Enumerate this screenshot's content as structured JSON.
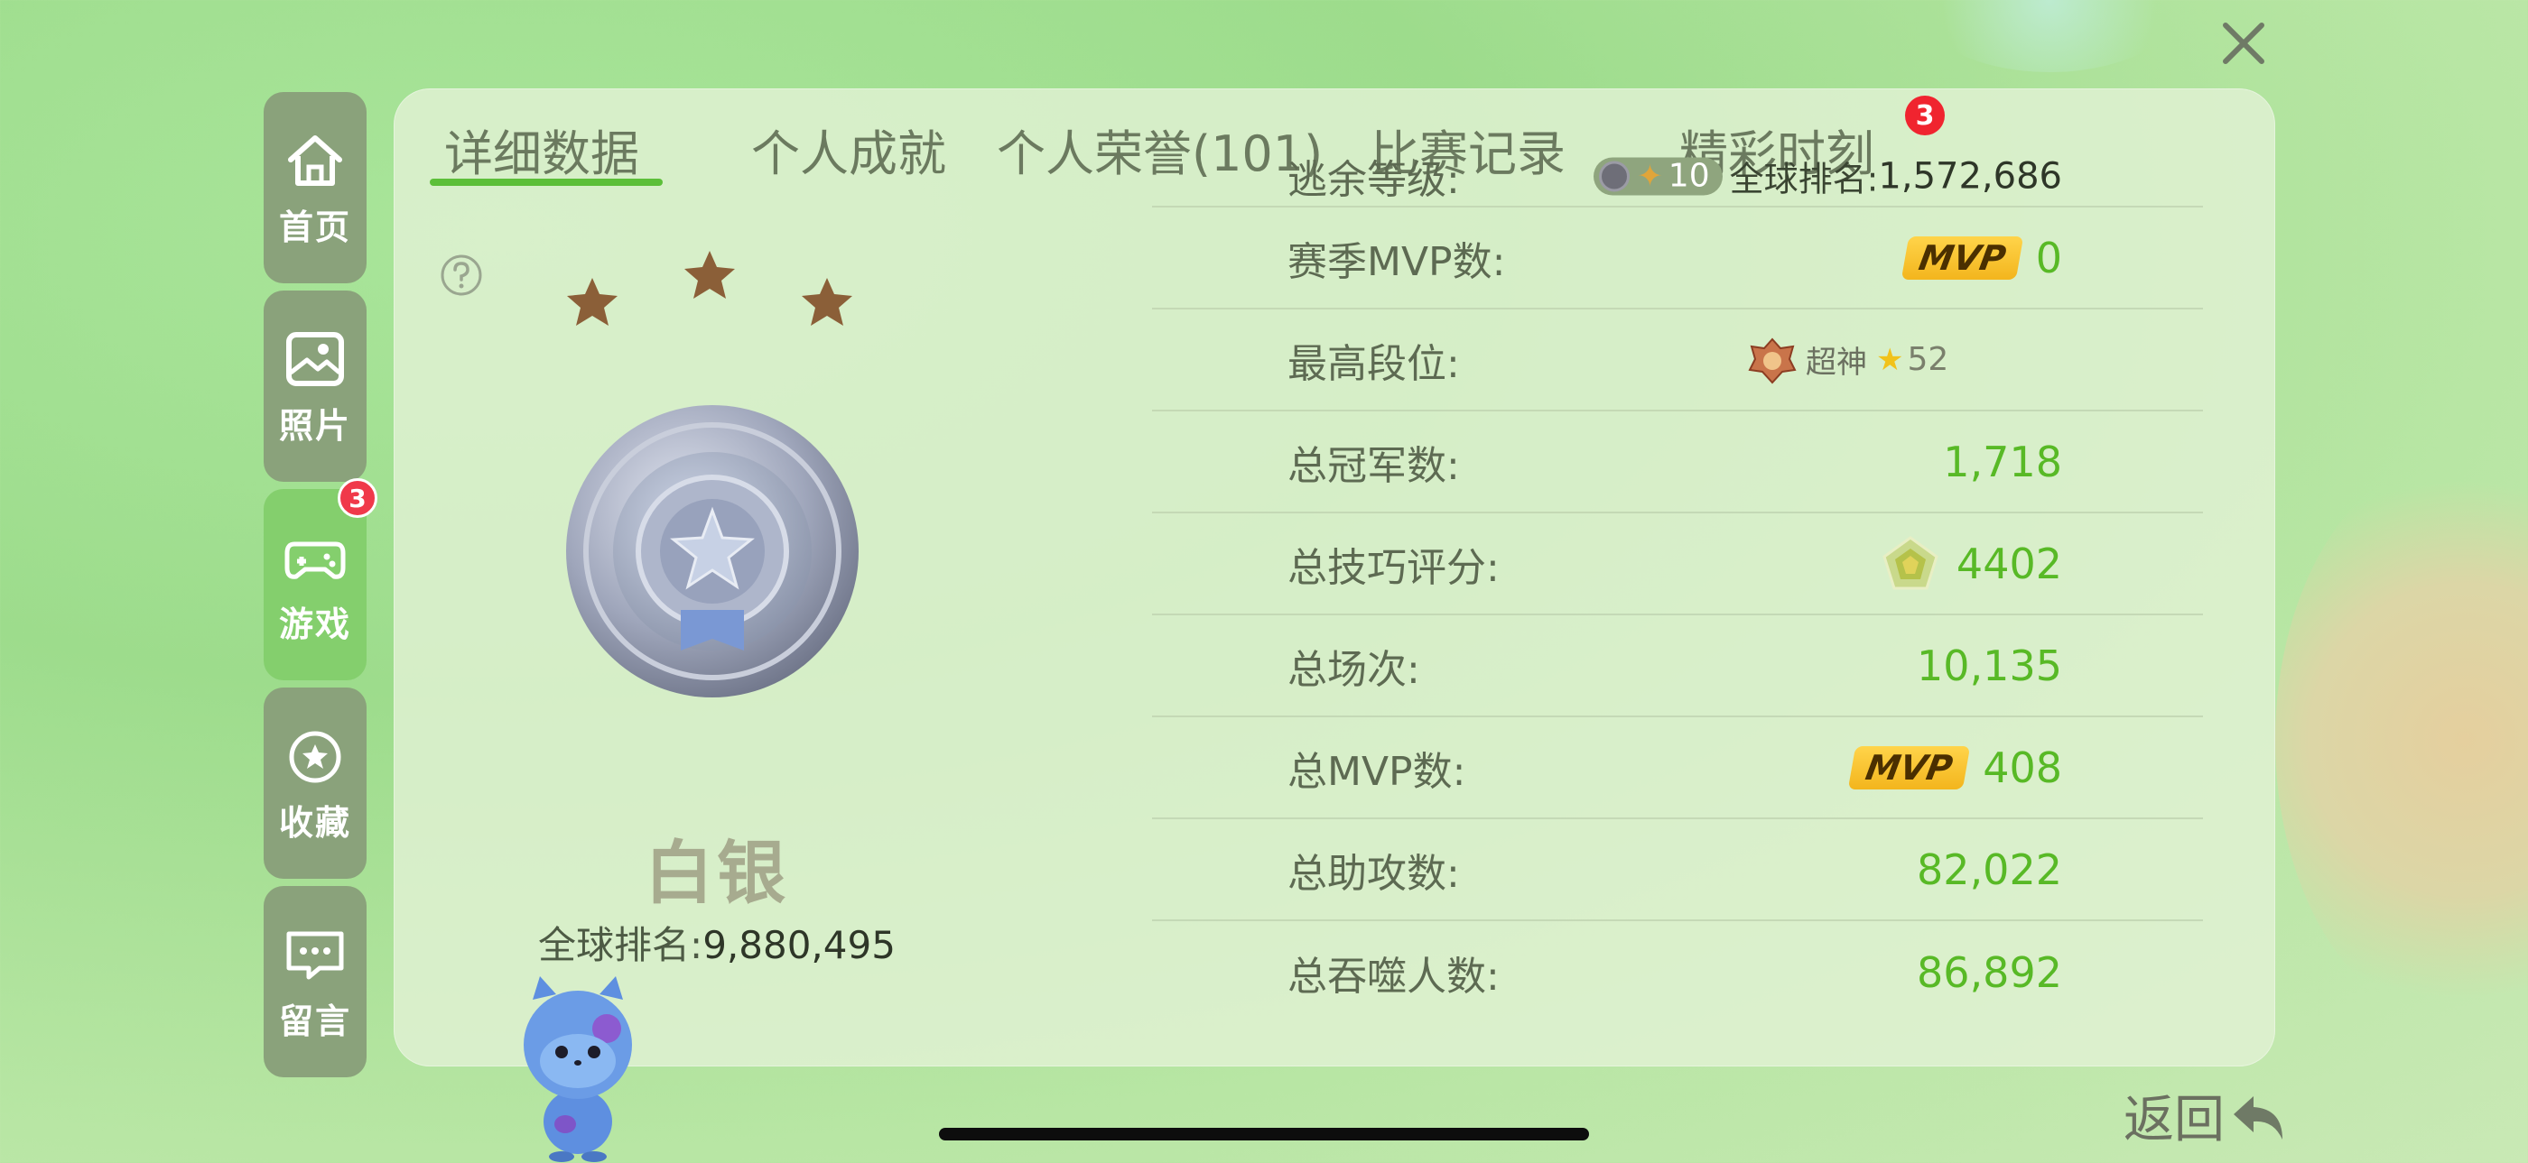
{
  "sidebar": {
    "items": [
      {
        "label": "首页",
        "icon": "home-icon"
      },
      {
        "label": "照片",
        "icon": "photo-icon"
      },
      {
        "label": "游戏",
        "icon": "gamepad-icon",
        "badge": "3"
      },
      {
        "label": "收藏",
        "icon": "star-icon"
      },
      {
        "label": "留言",
        "icon": "message-icon"
      }
    ]
  },
  "tabs": [
    {
      "label": "详细数据",
      "active": true
    },
    {
      "label": "个人成就"
    },
    {
      "label": "个人荣誉(101)"
    },
    {
      "label": "比赛记录"
    },
    {
      "label": "精彩时刻",
      "badge": "3"
    }
  ],
  "rank": {
    "name": "白银",
    "global_label": "全球排名:",
    "global_value": "9,880,495"
  },
  "stats": [
    {
      "label": "逃余等级:",
      "level": "10",
      "global_label": "全球排名:",
      "global_value": "1,572,686"
    },
    {
      "label": "赛季MVP数:",
      "mvp_tag": "MVP",
      "value": "0"
    },
    {
      "label": "最高段位:",
      "peak_name": "超神",
      "peak_star": "★",
      "peak_stars": "52"
    },
    {
      "label": "总冠军数:",
      "value": "1,718"
    },
    {
      "label": "总技巧评分:",
      "value": "4402"
    },
    {
      "label": "总场次:",
      "value": "10,135"
    },
    {
      "label": "总MVP数:",
      "mvp_tag": "MVP",
      "value": "408"
    },
    {
      "label": "总助攻数:",
      "value": "82,022"
    },
    {
      "label": "总吞噬人数:",
      "value": "86,892"
    }
  ],
  "back_label": "返回",
  "colors": {
    "accent": "#58b926",
    "sidebar": "#8aa27b",
    "sidebar_active": "#84cf6d",
    "badge": "#f0394a"
  }
}
